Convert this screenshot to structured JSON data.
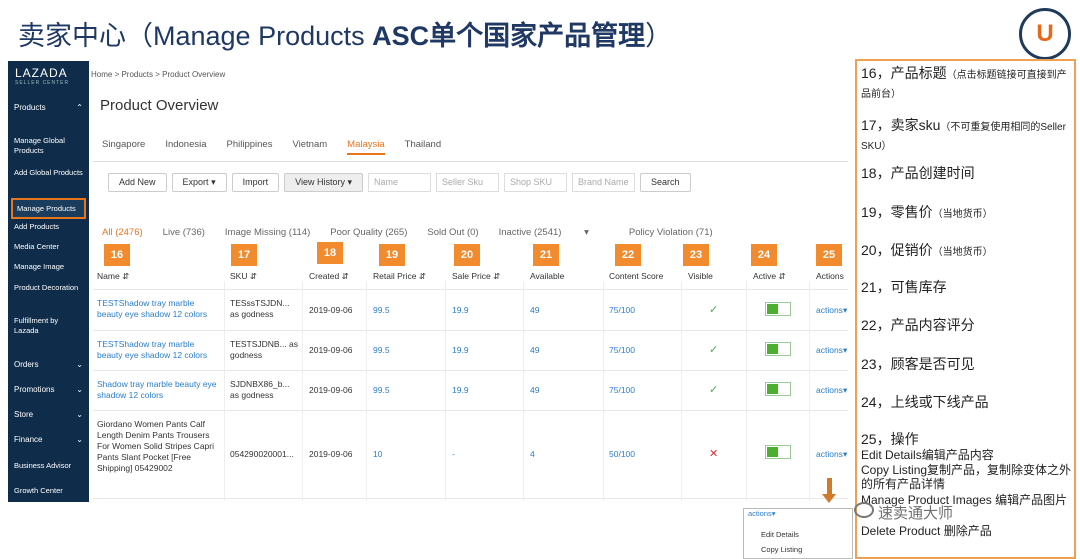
{
  "slide": {
    "title_cn": "卖家中心（",
    "title_en": "Manage Products ",
    "title_bold": "ASC单个国家产品管理",
    "title_end": "）",
    "logo_letter": "U"
  },
  "sidebar": {
    "brand": "LAZADA",
    "brand_sub": "SELLER CENTER",
    "products_section": "Products",
    "items": [
      "Manage Global Products",
      "Add Global Products",
      "Manage Products",
      "Add Products",
      "Media Center",
      "Manage Image",
      "Product Decoration",
      "Fulfillment by Lazada"
    ],
    "sections": [
      "Orders",
      "Promotions",
      "Store",
      "Finance",
      "Business Advisor",
      "Growth Center"
    ],
    "active": "Manage Products"
  },
  "breadcrumb": "Home  >  Products  >  Product Overview",
  "page_title": "Product Overview",
  "countries": [
    "Singapore",
    "Indonesia",
    "Philippines",
    "Vietnam",
    "Malaysia",
    "Thailand"
  ],
  "active_country": "Malaysia",
  "toolbar": {
    "add_new": "Add New",
    "export": "Export",
    "import": "Import",
    "view_history": "View History",
    "name_placeholder": "Name",
    "seller_sku_placeholder": "Seller Sku",
    "shop_sku_placeholder": "Shop SKU",
    "brand_placeholder": "Brand Name",
    "search": "Search"
  },
  "filters": [
    "All (2476)",
    "Live (736)",
    "Image Missing (114)",
    "Poor Quality (265)",
    "Sold Out (0)",
    "Inactive (2541)",
    "Policy Violation (71)"
  ],
  "markers": [
    "16",
    "17",
    "18",
    "19",
    "20",
    "21",
    "22",
    "23",
    "24",
    "25"
  ],
  "columns": [
    "Name",
    "SKU",
    "Created",
    "Retail Price",
    "Sale Price",
    "Available",
    "Content Score",
    "Visible",
    "Active",
    "Actions"
  ],
  "rows": [
    {
      "name": "TESTShadow tray marble beauty eye shadow 12 colors",
      "sku": "TESssTSJDN... as godness",
      "created": "2019-09-06",
      "retail": "99.5",
      "sale": "19.9",
      "available": "49",
      "score": "75/100",
      "visible": true,
      "action": "actions"
    },
    {
      "name": "TESTShadow tray marble beauty eye shadow 12 colors",
      "sku": "TESTSJDNB... as godness",
      "created": "2019-09-06",
      "retail": "99.5",
      "sale": "19.9",
      "available": "49",
      "score": "75/100",
      "visible": true,
      "action": "actions"
    },
    {
      "name": "Shadow tray marble beauty eye shadow 12 colors",
      "sku": "SJDNBX86_b... as godness",
      "created": "2019-09-06",
      "retail": "99.5",
      "sale": "19.9",
      "available": "49",
      "score": "75/100",
      "visible": true,
      "action": "actions"
    },
    {
      "name": "Giordano Women Pants Calf Length Denim Pants Trousers For Women Solid Stripes Capri Pants Slant Pocket [Free Shipping] 05429002",
      "sku": "054290020001...",
      "created": "2019-09-06",
      "retail": "10",
      "sale": "-",
      "available": "4",
      "score": "50/100",
      "visible": false,
      "action": "actions"
    }
  ],
  "notes": {
    "n16": "16，产品标题",
    "n16_small": "（点击标题链接可直接到产品前台）",
    "n17": "17，卖家sku",
    "n17_small": "（不可重复使用相同的Seller SKU）",
    "n18": "18，产品创建时间",
    "n19": "19，零售价",
    "n19_small": "（当地货币）",
    "n20": "20，促销价",
    "n20_small": "（当地货币）",
    "n21": "21，可售库存",
    "n22": "22，产品内容评分",
    "n23": "23，顾客是否可见",
    "n24": "24，上线或下线产品",
    "n25": "25，操作",
    "n25_a": "Edit Details编辑产品内容",
    "n25_b": "Copy Listing复制产品，复制除变体之外的所有产品详情",
    "n25_c": "Manage Product Images 编辑产品图片",
    "n25_d": "Delete Product 删除产品"
  },
  "dropdown": {
    "header": "actions",
    "items": [
      "Edit Details",
      "Copy Listing"
    ]
  },
  "watermark": "速卖通大师",
  "colors": {
    "accent": "#e8741c",
    "sidebar": "#0f2d4a",
    "link": "#2a7ec9",
    "marker": "#f28a2e"
  }
}
